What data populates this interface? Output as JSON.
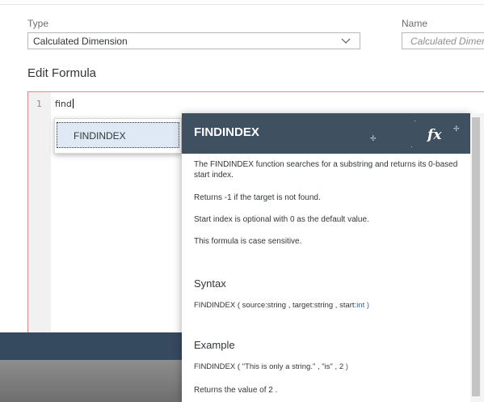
{
  "type_field": {
    "label": "Type",
    "value": "Calculated Dimension"
  },
  "name_field": {
    "label": "Name",
    "placeholder": "Calculated Dimension"
  },
  "editor": {
    "section_title": "Edit Formula",
    "line_number": "1",
    "code_text": "find"
  },
  "suggestions": [
    {
      "label": "FINDINDEX"
    }
  ],
  "doc_panel": {
    "title": "FINDINDEX",
    "fx_icon": "fx",
    "description": [
      "The FINDINDEX function searches for a substring and returns its 0-based start index.",
      "Returns -1 if the target is not found.",
      "Start index is optional with 0 as the default value.",
      "This formula is case sensitive."
    ],
    "syntax_heading": "Syntax",
    "syntax": {
      "fn": "FINDINDEX",
      "open": "(",
      "arg1": "source:string",
      "sep1": ",",
      "arg2": "target:string",
      "sep2": ",",
      "arg3_name": "start:",
      "arg3_type": "int",
      "close": ")"
    },
    "example_heading": "Example",
    "example": {
      "fn": "FINDINDEX",
      "open": "(",
      "arg1": "\"This is only a string.\"",
      "sep1": ",",
      "arg2": "\"is\"",
      "sep2": ",",
      "arg3": "2",
      "close": ")"
    },
    "result": "Returns the value of 2 ."
  },
  "colors": {
    "doc_header": "#3f5161",
    "editor_border": "#e9888a",
    "dark_bar": "#354a5f",
    "syntax_type": "#2a64c3"
  }
}
